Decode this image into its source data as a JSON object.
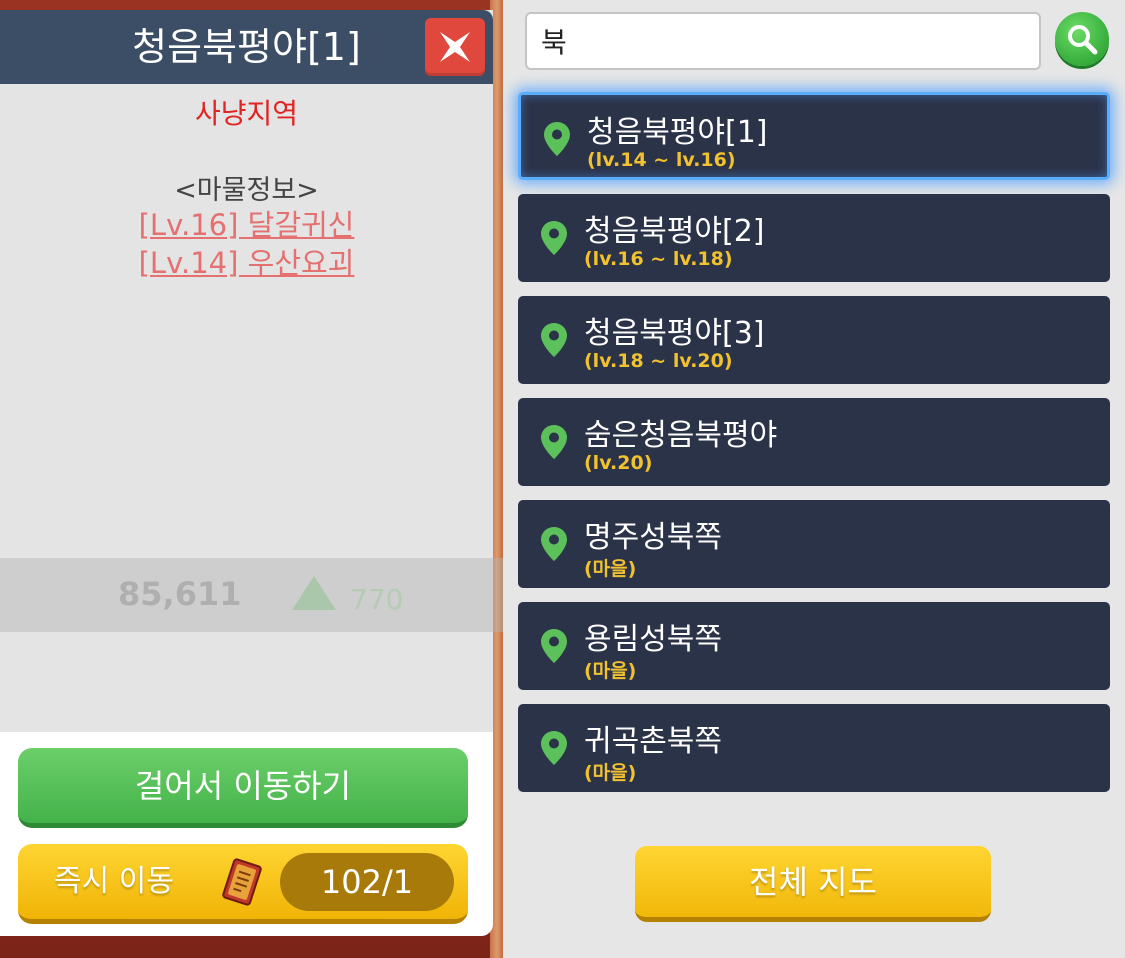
{
  "detail": {
    "title": "청음북평야[1]",
    "zone_type": "사냥지역",
    "monster_header": "<마물정보>",
    "monsters": [
      {
        "label": "[Lv.16] 달갈귀신"
      },
      {
        "label": "[Lv.14] 우산요괴"
      }
    ],
    "walk_button": "걸어서 이동하기",
    "teleport_button": "즉시 이동",
    "teleport_count": "102/1",
    "overlay": {
      "number": "85,611",
      "value": "770"
    }
  },
  "search": {
    "value": "북",
    "results": [
      {
        "name": "청음북평야[1]",
        "sub": "(lv.14 ~ lv.16)",
        "selected": true
      },
      {
        "name": "청음북평야[2]",
        "sub": "(lv.16 ~ lv.18)",
        "selected": false
      },
      {
        "name": "청음북평야[3]",
        "sub": "(lv.18 ~ lv.20)",
        "selected": false
      },
      {
        "name": "숨은청음북평야",
        "sub": "(lv.20)",
        "selected": false
      },
      {
        "name": "명주성북쪽",
        "sub": "(마을)",
        "selected": false
      },
      {
        "name": "용림성북쪽",
        "sub": "(마을)",
        "selected": false
      },
      {
        "name": "귀곡촌북쪽",
        "sub": "(마을)",
        "selected": false
      }
    ]
  },
  "full_map_button": "전체 지도",
  "colors": {
    "header_bg": "#3c4d66",
    "close_red": "#e0483e",
    "zone_red": "#e02424",
    "link_pink": "#e57070",
    "walk_green": "#44b24a",
    "gold": "#f0b406",
    "item_bg": "#2b3349",
    "sub_yellow": "#f2c12e",
    "pin_green": "#5cc15a",
    "selected_glow": "#5aaeff"
  },
  "icons": {
    "close": "close-x-icon",
    "search": "magnifier-icon",
    "pin": "map-pin-icon",
    "scroll": "teleport-scroll-icon",
    "overlay": "triangle-up-icon"
  }
}
